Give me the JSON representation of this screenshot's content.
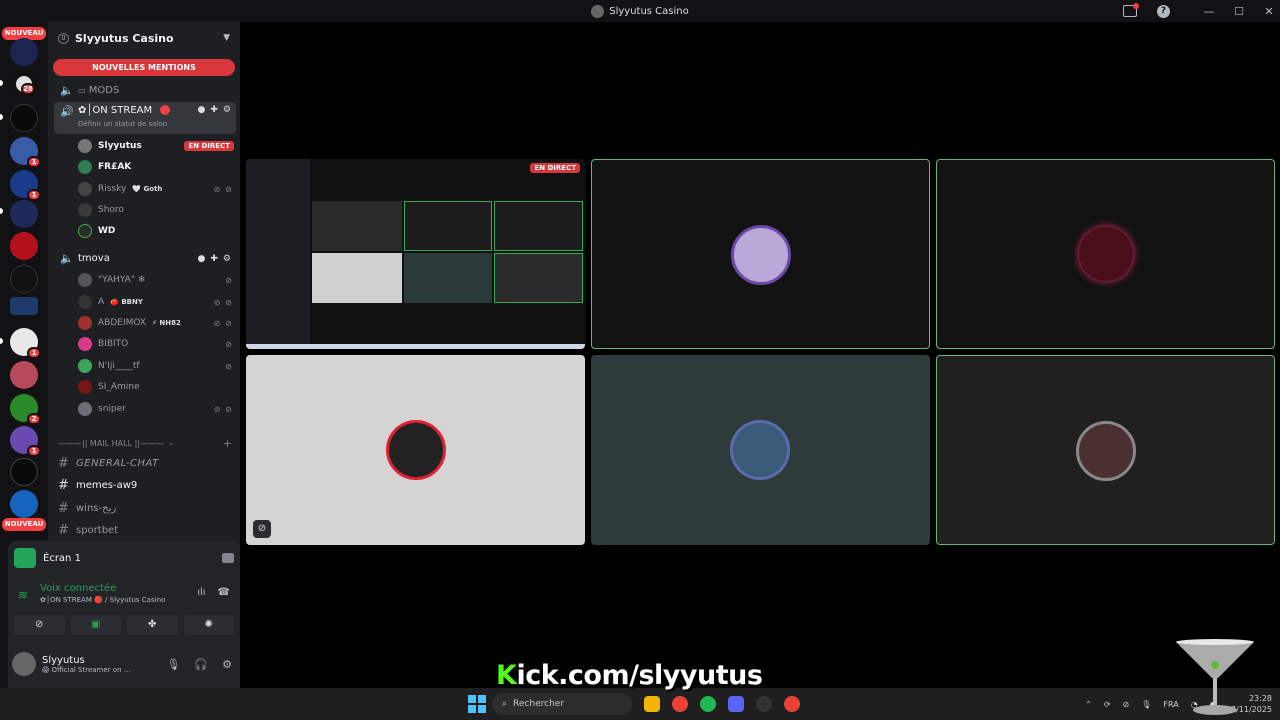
{
  "window": {
    "title": "Slyyutus Casino",
    "controls": [
      "—",
      "☐",
      "✕"
    ]
  },
  "servers": {
    "new_label": "NOUVEAU",
    "new_label_bottom": "NOUVEAU",
    "badges": [
      "28",
      "1",
      "1",
      "1",
      "2",
      "1"
    ]
  },
  "server": {
    "name": "Slyyutus Casino",
    "boost_count": "0",
    "new_mentions": "NOUVELLES MENTIONS"
  },
  "channels": {
    "mods": "MODS",
    "on_stream": "✿│ON STREAM",
    "on_stream_status": "Définir un statut de salon",
    "tmova": "tmova"
  },
  "on_stream_users": [
    {
      "name": "Slyyutus",
      "badge": "EN DIRECT"
    },
    {
      "name": "FR£AK"
    },
    {
      "name": "Rissky",
      "tag": "🤍 Goth"
    },
    {
      "name": "Shoro"
    },
    {
      "name": "WD"
    }
  ],
  "tmova_users": [
    {
      "name": "\"YAHYA\" ❄"
    },
    {
      "name": "A",
      "tag": "🍅 BBNY"
    },
    {
      "name": "ABDEIMOX",
      "tag": "⚡ NH82"
    },
    {
      "name": "BIBITO"
    },
    {
      "name": "N'Iji____tf"
    },
    {
      "name": "SI_Amine"
    },
    {
      "name": "sniper"
    }
  ],
  "category": {
    "name": "———|| MAIL HALL ||———"
  },
  "text_channels": [
    {
      "name": "GENERAL-CHAT"
    },
    {
      "name": "memes-aw9"
    },
    {
      "name": "wins-ربح"
    },
    {
      "name": "sportbet"
    }
  ],
  "panel": {
    "screen": "Écran 1",
    "voice_connected": "Voix connectée",
    "voice_channel": "✿│ON STREAM 🔴 / Slyyutus Casino",
    "username": "Slyyutus",
    "user_status": "😱 Official Streamer on ..."
  },
  "stage": {
    "live_badge": "EN DIRECT"
  },
  "overlay": {
    "kick_k": "K",
    "kick_rest": "ick.com/slyyutus"
  },
  "taskbar": {
    "search_placeholder": "Rechercher",
    "lang": "FRA",
    "time": "23:28",
    "date": "07/11/2025"
  },
  "colors": {
    "accent_red": "#da373c",
    "voice_green": "#23a55a",
    "speaking_border": "#6ab86f",
    "kick_green": "#53fc18"
  }
}
